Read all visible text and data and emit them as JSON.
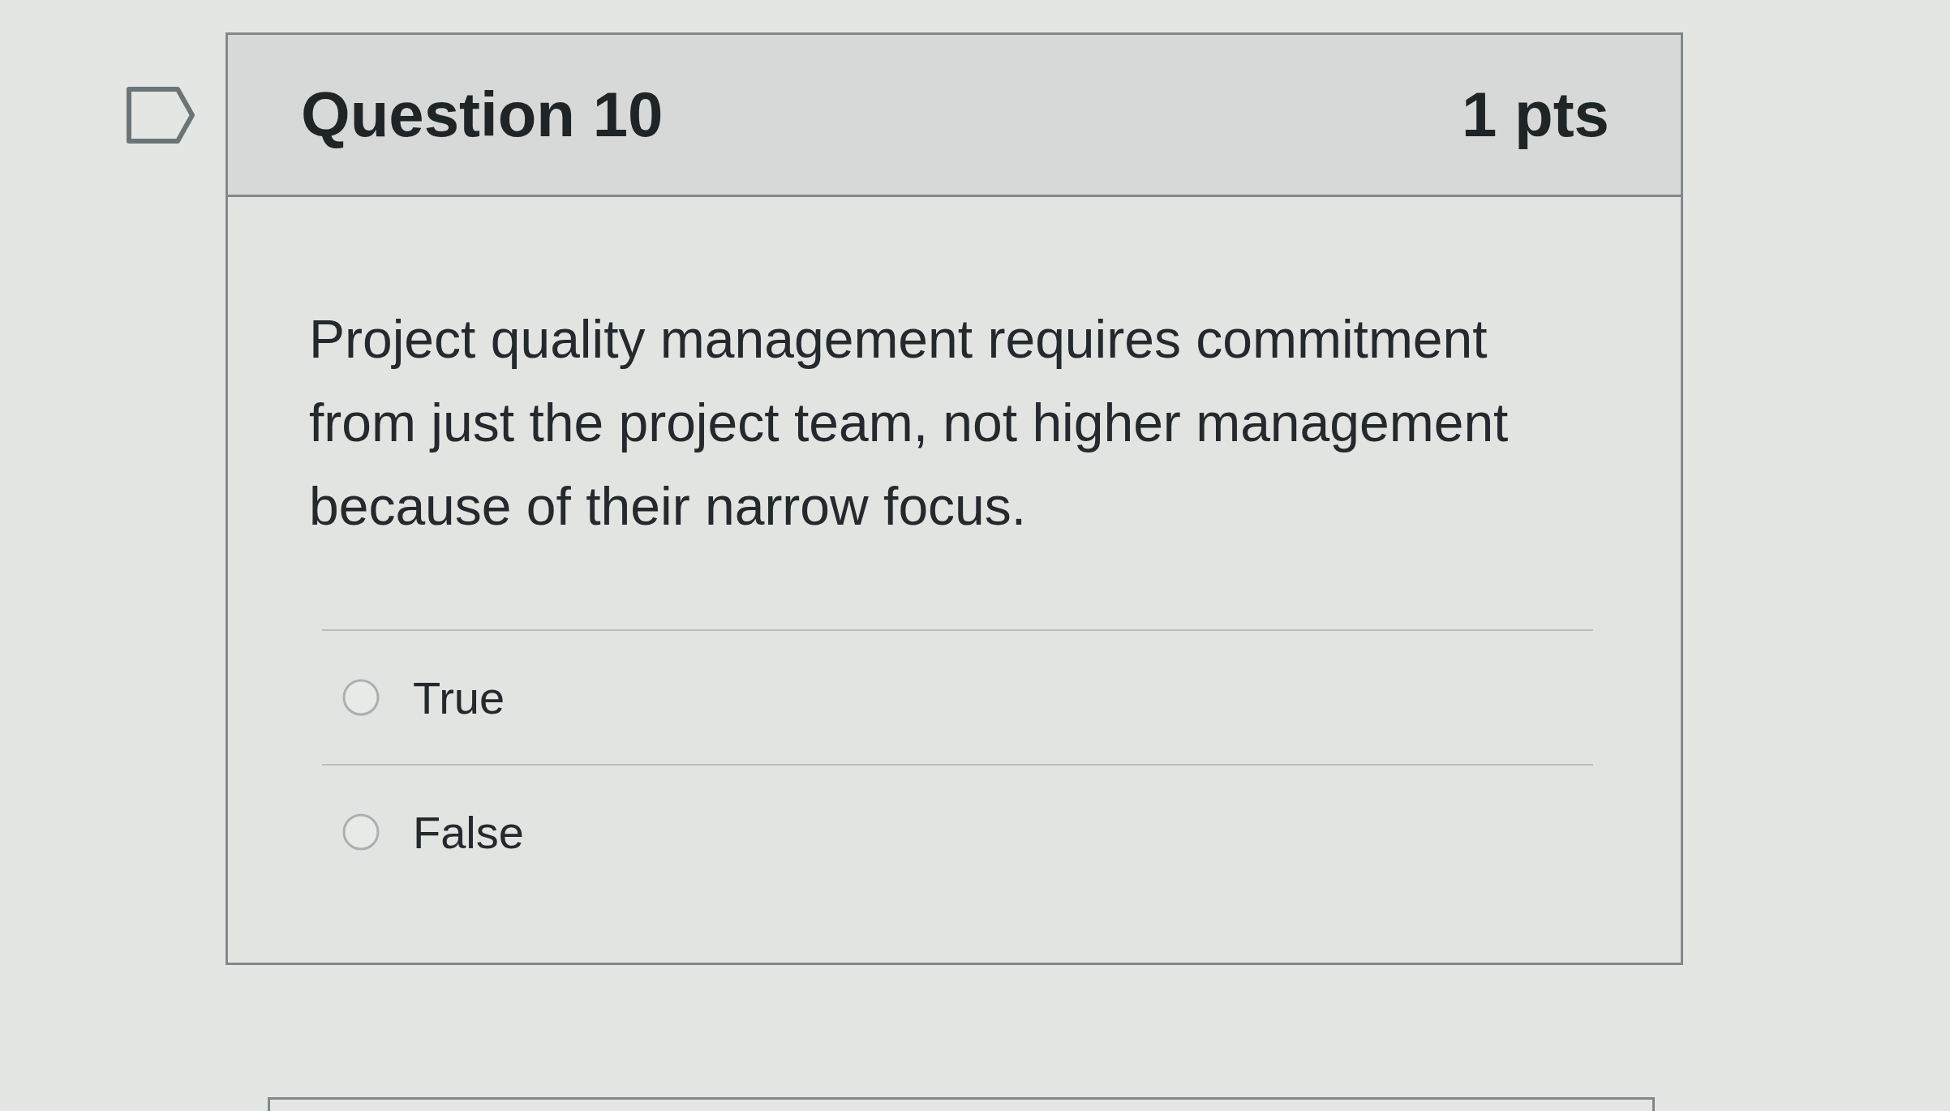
{
  "question": {
    "title": "Question 10",
    "points": "1 pts",
    "text": "Project quality management requires commitment from just the project team, not higher management because of their narrow focus.",
    "answers": [
      {
        "label": "True",
        "selected": false
      },
      {
        "label": "False",
        "selected": false
      }
    ]
  }
}
